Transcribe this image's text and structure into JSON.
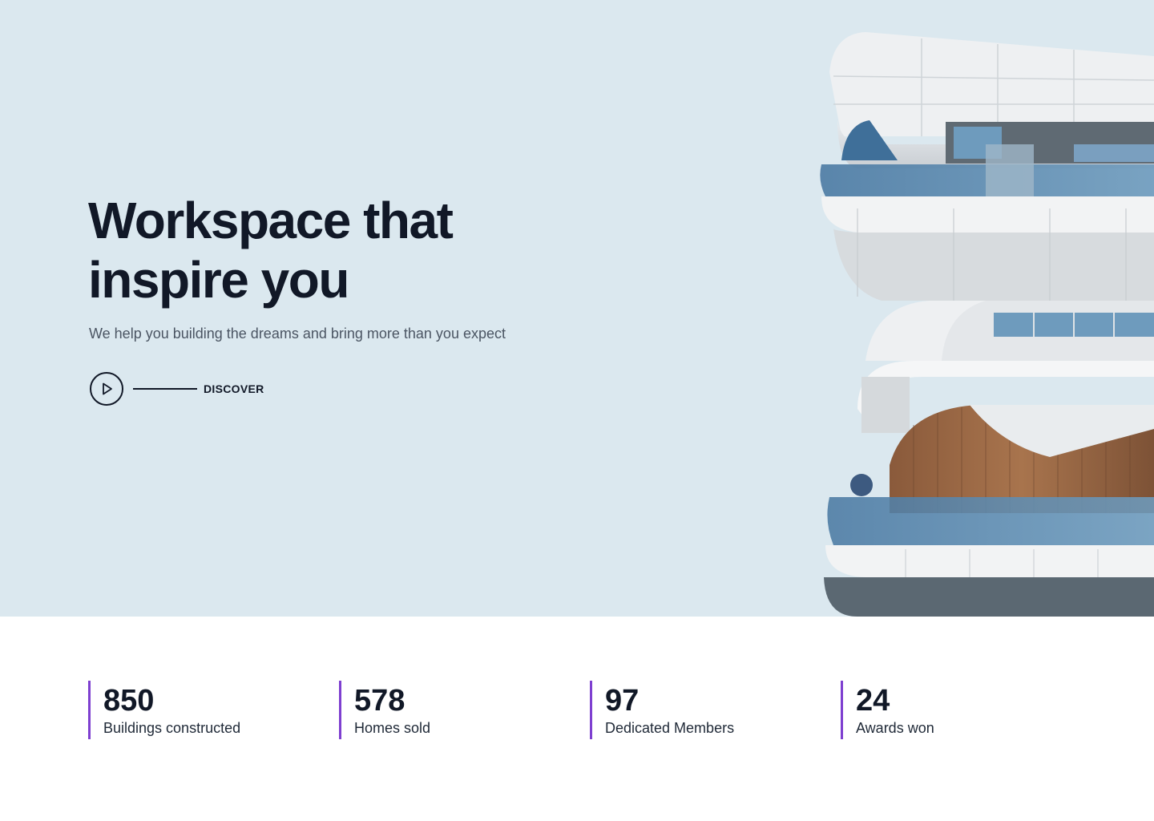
{
  "hero": {
    "title_line1": "Workspace that",
    "title_line2": "inspire you",
    "subtitle": "We help you building the dreams and bring more than you expect",
    "discover_label": "DISCOVER",
    "building_image": "modern-building-photo"
  },
  "stats": [
    {
      "value": "850",
      "label": "Buildings constructed"
    },
    {
      "value": "578",
      "label": "Homes sold"
    },
    {
      "value": "97",
      "label": "Dedicated Members"
    },
    {
      "value": "24",
      "label": "Awards won"
    }
  ],
  "colors": {
    "hero_background": "#dbe8ef",
    "text_dark": "#111827",
    "text_muted": "#4b5563",
    "accent_purple": "#7e3fd0"
  },
  "icons": {
    "play": "play-icon"
  }
}
